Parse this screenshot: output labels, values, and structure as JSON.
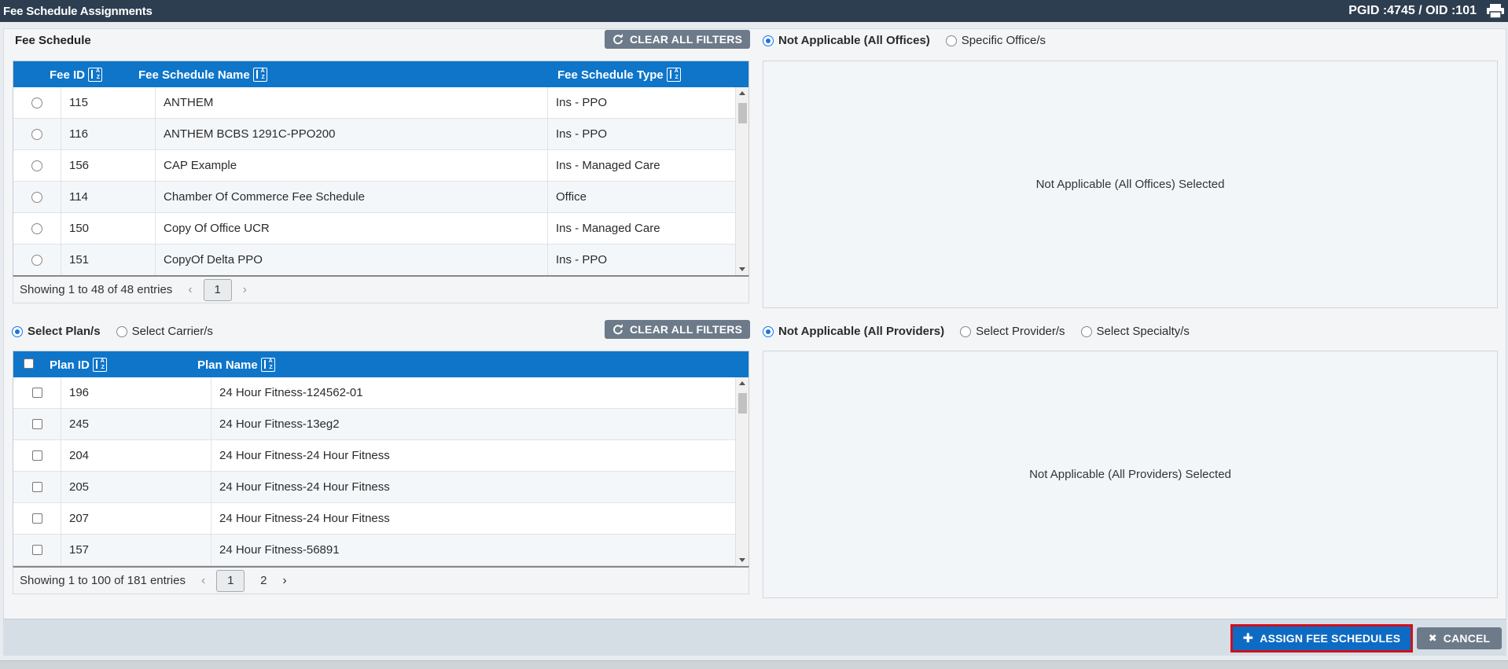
{
  "window": {
    "title": "Fee Schedule Assignments",
    "ids": "PGID :4745  /  OID :101",
    "print_icon": "printer-icon"
  },
  "fee_schedule": {
    "label": "Fee Schedule",
    "clear_filters": "CLEAR ALL FILTERS",
    "columns": [
      "Fee ID",
      "Fee Schedule Name",
      "Fee Schedule Type"
    ],
    "rows": [
      {
        "id": "115",
        "name": "ANTHEM",
        "type": "Ins - PPO"
      },
      {
        "id": "116",
        "name": "ANTHEM BCBS 1291C-PPO200",
        "type": "Ins - PPO"
      },
      {
        "id": "156",
        "name": "CAP Example",
        "type": "Ins - Managed Care"
      },
      {
        "id": "114",
        "name": "Chamber Of Commerce Fee Schedule",
        "type": "Office"
      },
      {
        "id": "150",
        "name": "Copy Of Office UCR",
        "type": "Ins - Managed Care"
      },
      {
        "id": "151",
        "name": "CopyOf Delta PPO",
        "type": "Ins - PPO"
      }
    ],
    "showing": "Showing 1 to 48 of 48 entries",
    "pages": [
      "1"
    ]
  },
  "offices": {
    "options": [
      "Not Applicable (All Offices)",
      "Specific Office/s"
    ],
    "selected": "Not Applicable (All Offices)",
    "panel_text": "Not Applicable (All Offices) Selected"
  },
  "plans": {
    "options": [
      "Select Plan/s",
      "Select Carrier/s"
    ],
    "selected": "Select Plan/s",
    "clear_filters": "CLEAR ALL FILTERS",
    "columns": [
      "Plan ID",
      "Plan Name"
    ],
    "rows": [
      {
        "id": "196",
        "name": "24 Hour Fitness-124562-01"
      },
      {
        "id": "245",
        "name": "24 Hour Fitness-13eg2"
      },
      {
        "id": "204",
        "name": "24 Hour Fitness-24 Hour Fitness"
      },
      {
        "id": "205",
        "name": "24 Hour Fitness-24 Hour Fitness"
      },
      {
        "id": "207",
        "name": "24 Hour Fitness-24 Hour Fitness"
      },
      {
        "id": "157",
        "name": "24 Hour Fitness-56891"
      }
    ],
    "showing": "Showing 1 to 100 of 181 entries",
    "pages": [
      "1",
      "2"
    ]
  },
  "providers": {
    "options": [
      "Not Applicable (All Providers)",
      "Select Provider/s",
      "Select Specialty/s"
    ],
    "selected": "Not Applicable (All Providers)",
    "panel_text": "Not Applicable (All Providers) Selected"
  },
  "footer": {
    "assign": "ASSIGN FEE SCHEDULES",
    "cancel": "CANCEL"
  }
}
